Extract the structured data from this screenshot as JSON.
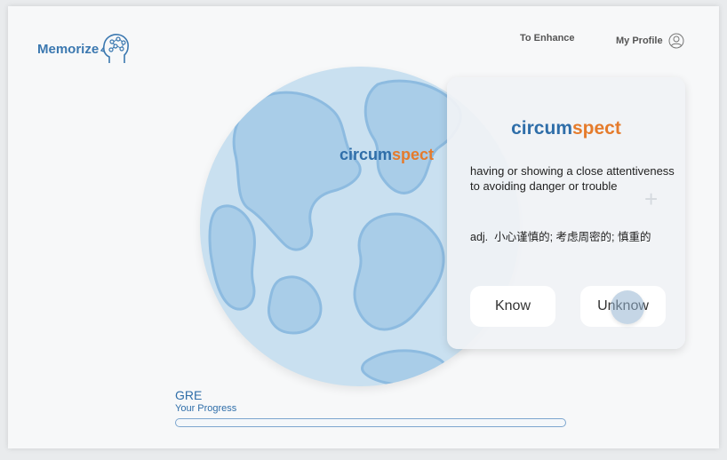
{
  "app": {
    "name": "Memorize"
  },
  "nav": {
    "enhance_label": "To Enhance",
    "profile_label": "My Profile"
  },
  "word": {
    "prefix": "circum",
    "suffix": "spect",
    "definition": "having or showing a close attentiveness to avoiding danger or trouble",
    "part_of_speech": "adj.",
    "translation": "小心谨慎的; 考虑周密的; 慎重的"
  },
  "actions": {
    "know_label": "Know",
    "unknow_label": "Unknow"
  },
  "progress": {
    "title": "GRE",
    "subtitle": "Your Progress",
    "fraction": 0
  },
  "colors": {
    "brand_blue": "#2f6ea9",
    "accent_orange": "#e57b2c",
    "globe_sea": "#c9e0f0",
    "globe_land": "#a9cde8"
  },
  "icons": {
    "logo": "brain-head-icon",
    "profile": "user-circle-icon"
  }
}
